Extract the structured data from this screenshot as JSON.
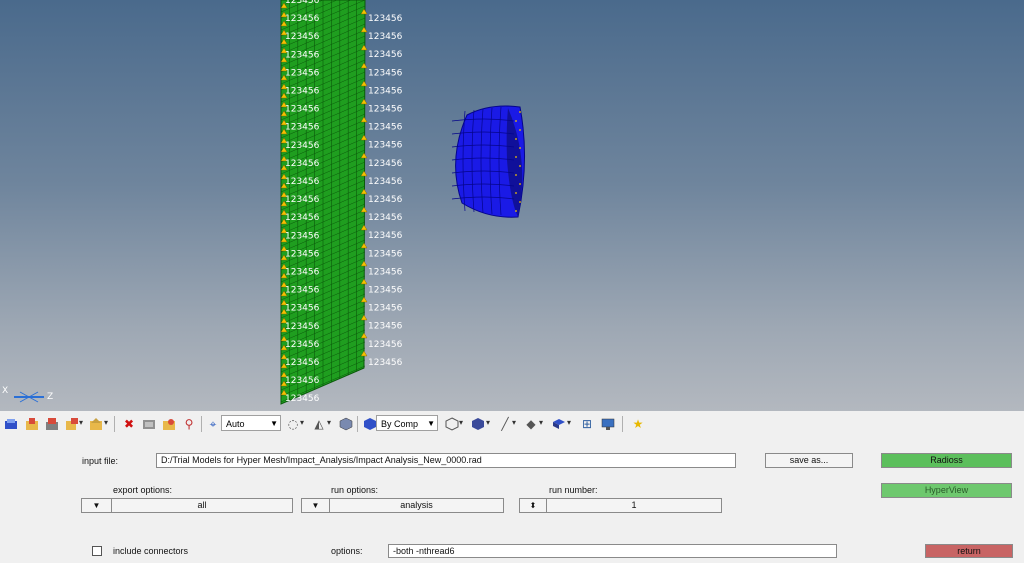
{
  "viewport": {
    "dof_label": "123456",
    "axis_x_label": "X",
    "axis_z_label": "Z",
    "colors": {
      "plate": "#1f9e1f",
      "impactor": "#1a1ae6",
      "constraint": "#f2c200"
    }
  },
  "toolbar": {
    "icons": [
      "import-icon",
      "open-model-icon",
      "save-icon",
      "export-icon",
      "import-geometry-icon",
      "delete-icon",
      "element-quality-icon",
      "find-icon",
      "visualization-icon"
    ],
    "orbit_mode": "Auto",
    "color_mode": "By Comp"
  },
  "panel": {
    "input_file_label": "input file:",
    "input_file_value": "D:/Trial Models for Hyper Mesh/Impact_Analysis/Impact Analysis_New_0000.rad",
    "save_as_label": "save as...",
    "radioss_label": "Radioss",
    "hyperview_label": "HyperView",
    "return_label": "return",
    "export_options_label": "export options:",
    "export_options_value": "all",
    "run_options_label": "run options:",
    "run_options_value": "analysis",
    "run_number_label": "run number:",
    "run_number_value": "1",
    "include_connectors_label": "include connectors",
    "include_connectors_checked": false,
    "options_label": "options:",
    "options_value": "-both -nthread6",
    "colors": {
      "radioss": "#5cbf5c",
      "hyperview": "#6ec86e",
      "return": "#c86464"
    }
  }
}
